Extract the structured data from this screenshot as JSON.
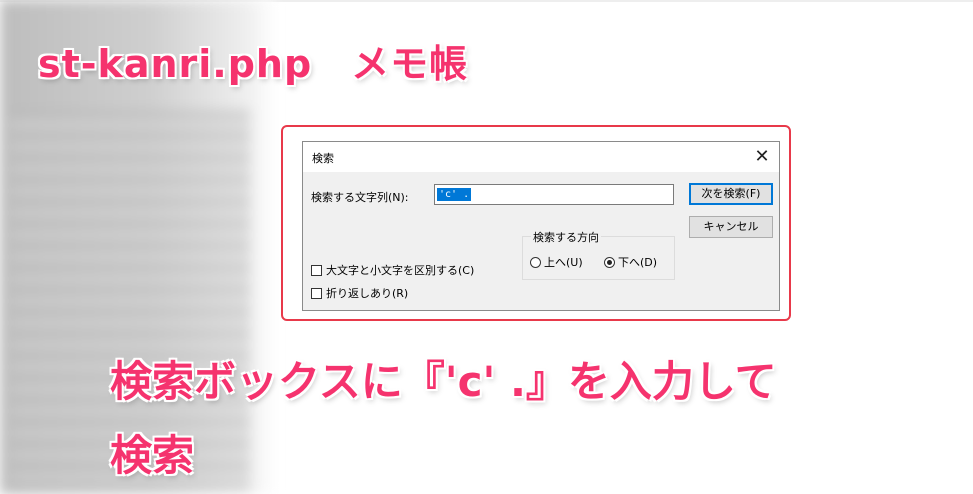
{
  "overlay": {
    "title": "st-kanri.php　メモ帳",
    "caption_line1": "検索ボックスに『'c' .』を入力して",
    "caption_line2": "検索"
  },
  "dialog": {
    "title": "検索",
    "close_glyph": "✕",
    "find_label": "検索する文字列(N):",
    "find_value": "'c' .",
    "find_next_label": "次を検索(F)",
    "cancel_label": "キャンセル",
    "direction_group": {
      "label": "検索する方向",
      "up_label": "上へ(U)",
      "down_label": "下へ(D)",
      "selected": "down"
    },
    "match_case": {
      "label": "大文字と小文字を区別する(C)",
      "checked": false
    },
    "wrap_around": {
      "label": "折り返しあり(R)",
      "checked": false
    }
  },
  "colors": {
    "accent_pink": "#f5336e",
    "highlight_border": "#e8394a",
    "selection_blue": "#0078d7",
    "dialog_bg": "#f0f0f0"
  },
  "icons": {
    "close": "close-icon",
    "radio_up": "radio-icon",
    "radio_down": "radio-selected-icon"
  }
}
